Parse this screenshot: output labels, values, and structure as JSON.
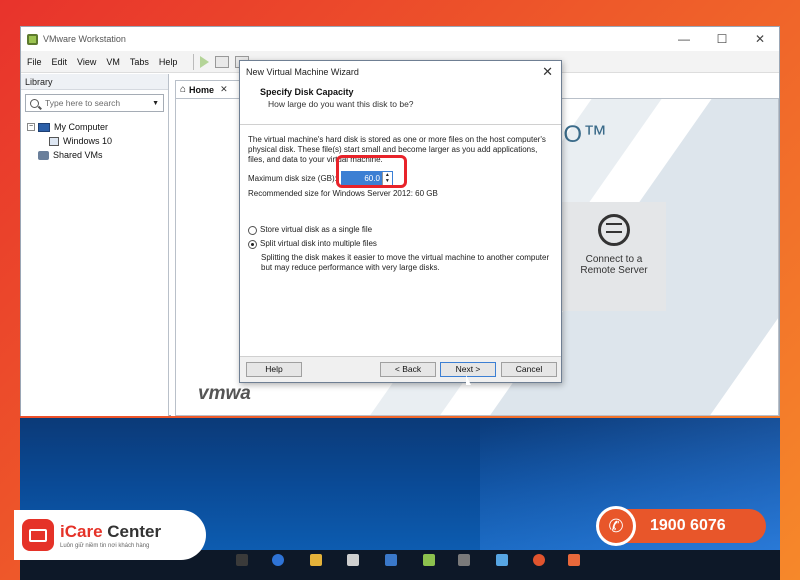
{
  "window": {
    "title": "VMware Workstation",
    "controls": [
      "—",
      "☐",
      "✕"
    ]
  },
  "menu": [
    {
      "label": "File"
    },
    {
      "label": "Edit"
    },
    {
      "label": "View"
    },
    {
      "label": "VM"
    },
    {
      "label": "Tabs"
    },
    {
      "label": "Help"
    }
  ],
  "library": {
    "header": "Library",
    "search_placeholder": "Type here to search",
    "tree": {
      "root": "My Computer",
      "child": "Windows 10",
      "shared": "Shared VMs"
    }
  },
  "home_tab": {
    "label": "Home"
  },
  "home_content": {
    "pro_text": "RO™",
    "remote_label_1": "Connect to a",
    "remote_label_2": "Remote Server",
    "brand_mark": "vmwa"
  },
  "dialog": {
    "title": "New Virtual Machine Wizard",
    "heading": "Specify Disk Capacity",
    "subheading": "How large do you want this disk to be?",
    "description": "The virtual machine's hard disk is stored as one or more files on the host computer's physical disk. These file(s) start small and become larger as you add applications, files, and data to your virtual machine.",
    "size_label": "Maximum disk size (GB):",
    "size_value": "60.0",
    "recommended": "Recommended size for Windows Server 2012: 60 GB",
    "option_single": "Store virtual disk as a single file",
    "option_multiple": "Split virtual disk into multiple files",
    "selected_option": "multiple",
    "split_note": "Splitting the disk makes it easier to move the virtual machine to another computer but may reduce performance with very large disks.",
    "buttons": {
      "help": "Help",
      "back": "< Back",
      "next": "Next >",
      "cancel": "Cancel"
    }
  },
  "branding": {
    "name_part1": "iCare",
    "name_part2": "Center",
    "tagline": "Luôn giữ niềm tin nơi khách hàng",
    "hotline": "1900 6076",
    "accent": "#e53228"
  }
}
